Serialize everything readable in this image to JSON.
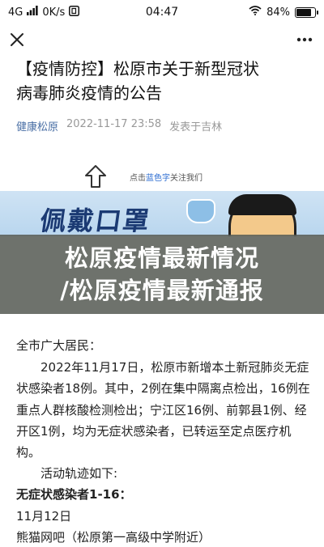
{
  "status_bar": {
    "network": "4G",
    "speed": "0K/s",
    "time": "04:47",
    "battery": "84%",
    "battery_level": 0.84
  },
  "nav": {
    "close_icon": "close-icon",
    "more_icon": "more-icon"
  },
  "article": {
    "title_line1": "【疫情防控】松原市关于新型冠状",
    "title_line2": "病毒肺炎疫情的公告",
    "source": "健康松原",
    "datetime": "2022-11-17 23:58",
    "location": "发表于吉林"
  },
  "banner": {
    "hint_prefix": "点击",
    "hint_highlight": "蓝色字",
    "hint_suffix": "关注我们",
    "headline": "佩戴口罩"
  },
  "overlay": {
    "line1": "松原疫情最新情况",
    "line2": "/松原疫情最新通报"
  },
  "body": {
    "greeting": "全市广大居民：",
    "paragraph": "2022年11月17日，松原市新增本土新冠肺炎无症状感染者18例。其中，2例在集中隔离点检出，16例在重点人群核酸检测检出；宁江区16例、前郭县1例、经开区1例，均为无症状感染者，已转运至定点医疗机构。",
    "track_heading": "活动轨迹如下:",
    "case_heading": "无症状感染者1-16：",
    "date": "11月12日",
    "location": "熊猫网吧（松原第一高级中学附近）"
  }
}
